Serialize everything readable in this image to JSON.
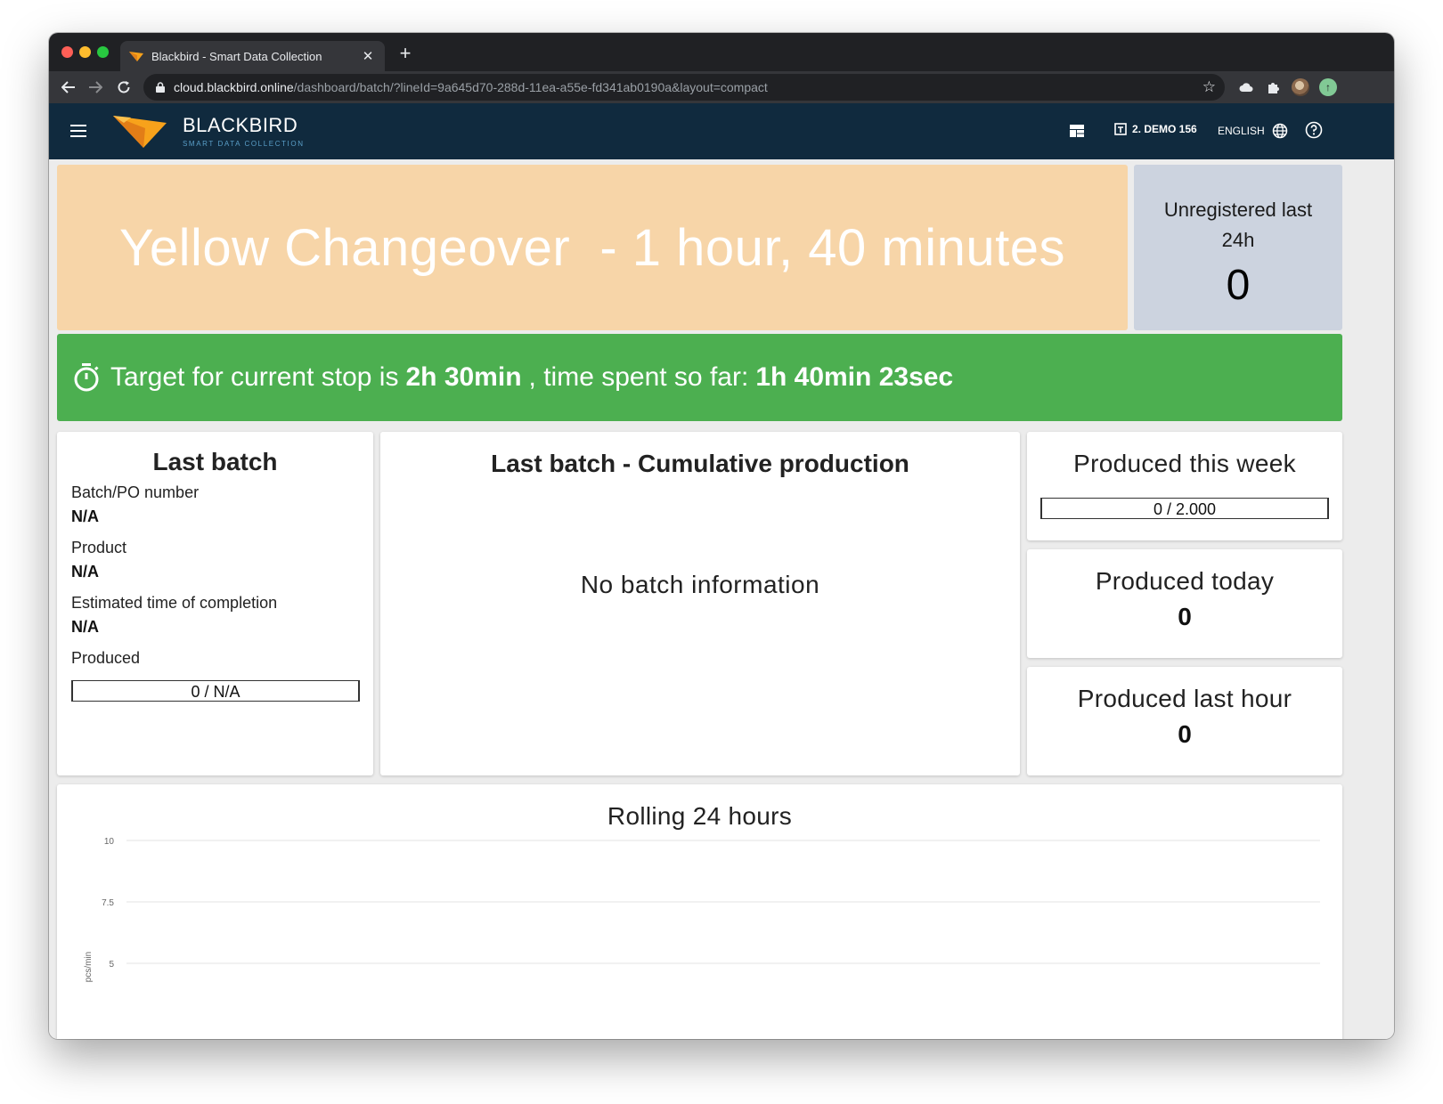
{
  "browser": {
    "tab_title": "Blackbird - Smart Data Collection",
    "tab_close": "✕",
    "new_tab": "+",
    "url_domain": "cloud.blackbird.online",
    "url_path": "/dashboard/batch/?lineId=9a645d70-288d-11ea-a55e-fd341ab0190a&layout=compact"
  },
  "appbar": {
    "brand_name": "BLACKBIRD",
    "brand_tagline": "SMART DATA COLLECTION",
    "line_selector": "2. DEMO 156",
    "language": "ENGLISH"
  },
  "status": {
    "text": "Yellow Changeover  - 1 hour, 40 minutes",
    "color": "#f7d5a8"
  },
  "unregistered": {
    "title": "Unregistered last 24h",
    "value": "0"
  },
  "target": {
    "prefix": "Target for current stop is",
    "target_time": "2h 30min",
    "middle": ", time spent so far:",
    "spent_time": "1h 40min 23sec",
    "color": "#4caf50"
  },
  "last_batch": {
    "heading": "Last batch",
    "batch_label": "Batch/PO number",
    "batch_value": "N/A",
    "product_label": "Product",
    "product_value": "N/A",
    "eta_label": "Estimated time of completion",
    "eta_value": "N/A",
    "produced_label": "Produced",
    "produced_value": "0 / N/A"
  },
  "cumulative": {
    "heading": "Last batch - Cumulative production",
    "empty_message": "No batch information"
  },
  "kpis": {
    "week_title": "Produced this week",
    "week_value": "0 / 2.000",
    "today_title": "Produced today",
    "today_value": "0",
    "lasthour_title": "Produced last hour",
    "lasthour_value": "0"
  },
  "chart_data": {
    "type": "line",
    "title": "Rolling 24 hours",
    "ylabel": "pcs/min",
    "xlabel": "",
    "ytick_labels": [
      "10",
      "7.5",
      "5"
    ],
    "yticks": [
      10,
      7.5,
      5
    ],
    "ylim": [
      5,
      10
    ],
    "grid": true,
    "series": []
  }
}
